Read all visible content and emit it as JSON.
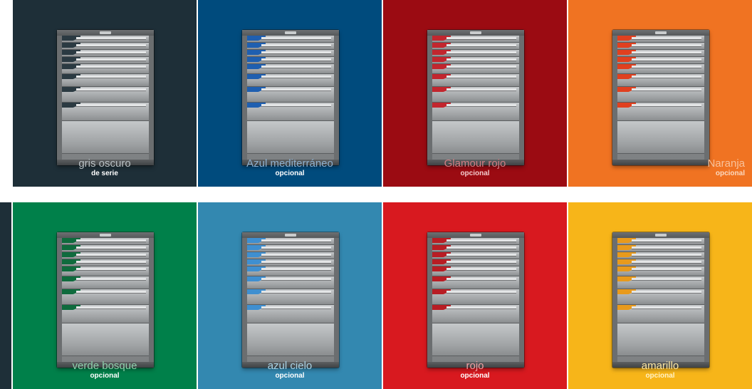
{
  "swatches": [
    {
      "name": "gris oscuro",
      "note": "de serie",
      "bg": "#1e2f38",
      "accent": "#2b3a42",
      "label_color": "#b8c0c4",
      "note_color": "#ffffff"
    },
    {
      "name": "Azul mediterráneo",
      "note": "opcional",
      "bg": "#004b7d",
      "accent": "#1f5fb0",
      "label_color": "#8fb1cf",
      "note_color": "#ffffff"
    },
    {
      "name": "Glamour rojo",
      "note": "opcional",
      "bg": "#9b0b12",
      "accent": "#c2262e",
      "label_color": "#d07f84",
      "note_color": "#f2cacc"
    },
    {
      "name": "Naranja",
      "note": "opcional",
      "bg": "#f07322",
      "accent": "#e0401f",
      "label_color": "#f8c29b",
      "note_color": "#fbd9c0"
    },
    {
      "name": "verde bosque",
      "note": "opcional",
      "bg": "#00804a",
      "accent": "#0f6b3d",
      "label_color": "#8fd0ad",
      "note_color": "#ffffff"
    },
    {
      "name": "azul cielo",
      "note": "opcional",
      "bg": "#3388b0",
      "accent": "#3f8fd0",
      "label_color": "#a9d3e6",
      "note_color": "#ffffff"
    },
    {
      "name": "rojo",
      "note": "opcional",
      "bg": "#d8191f",
      "accent": "#b81d24",
      "label_color": "#f0a0a3",
      "note_color": "#ffffff"
    },
    {
      "name": "amarillo",
      "note": "opcional",
      "bg": "#f7b519",
      "accent": "#e89a1c",
      "label_color": "#fbe6a2",
      "note_color": "#fff2c6"
    }
  ]
}
